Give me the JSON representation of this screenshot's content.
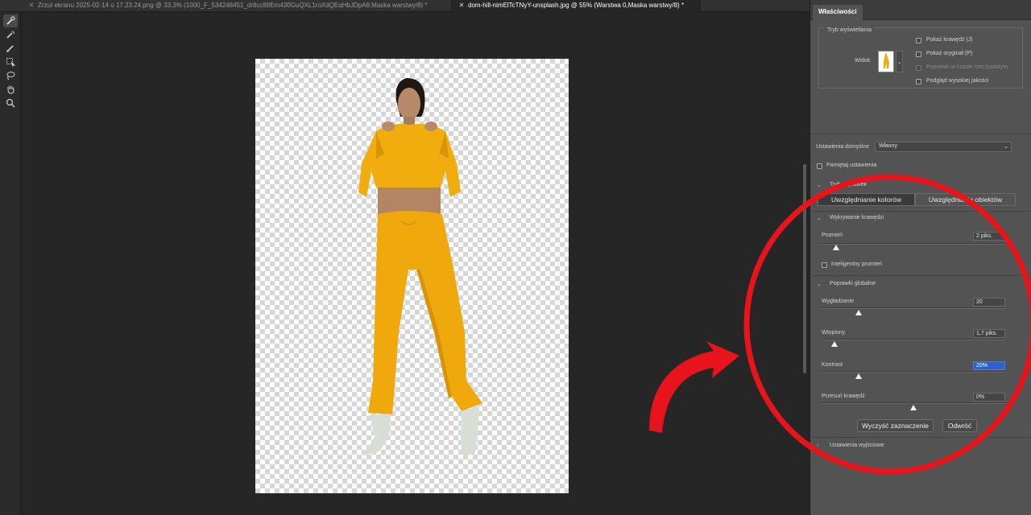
{
  "tabs": [
    {
      "label": "Zrzut ekranu 2025-02-14 o 17.23.24.png @ 33,3% (1000_F_534248451_dr8cc88Em430GuQXL1roXdQEqHbJDpA8,Maska warstwy/8) *",
      "active": false
    },
    {
      "label": "dom-hill-nimElTcTNyY-unsplash.jpg @ 55% (Warstwa 0,Maska warstwy/8) *",
      "active": true
    }
  ],
  "tools": [
    "quick-selection-icon",
    "refine-edge-brush-icon",
    "brush-icon",
    "object-selection-icon",
    "lasso-icon",
    "hand-icon",
    "zoom-icon"
  ],
  "panel": {
    "title": "Właściwości",
    "view_mode": {
      "title": "Tryb wyświetlania",
      "view_label": "Widok",
      "options": [
        {
          "label": "Pokaż krawędź (J)",
          "enabled": true
        },
        {
          "label": "Pokaż oryginał (P)",
          "enabled": true
        },
        {
          "label": "Poprawki w czasie rzeczywistym",
          "enabled": false
        },
        {
          "label": "Podgląd wysokiej jakości",
          "enabled": true
        }
      ]
    },
    "preset": {
      "label": "Ustawienia domyślne",
      "value": "Własny"
    },
    "remember_label": "Pamiętaj ustawienia",
    "refine_mode": {
      "title": "Tryb poprawek",
      "options": [
        "Uwzględnianie kolorów",
        "Uwzględnianie obiektów"
      ]
    },
    "edge_detection": {
      "title": "Wykrywanie krawędzi",
      "radius_label": "Promień",
      "radius_value": "2 piks.",
      "radius_pct": 0.08,
      "smart_radius_label": "Inteligentny promień"
    },
    "global": {
      "title": "Poprawki globalne",
      "sliders": [
        {
          "label": "Wygładzanie",
          "value": "20",
          "pct": 0.2
        },
        {
          "label": "Wtopiony",
          "value": "1,7 piks.",
          "pct": 0.07
        },
        {
          "label": "Kontrast",
          "value": "20%",
          "pct": 0.2
        },
        {
          "label": "Przesuń krawędź",
          "value": "0%",
          "pct": 0.5
        }
      ]
    },
    "buttons": {
      "clear": "Wyczyść zaznaczenie",
      "reset": "Odwróć"
    },
    "output_label": "Ustawienia wyjściowe"
  },
  "annotation_color": "#e8141c"
}
